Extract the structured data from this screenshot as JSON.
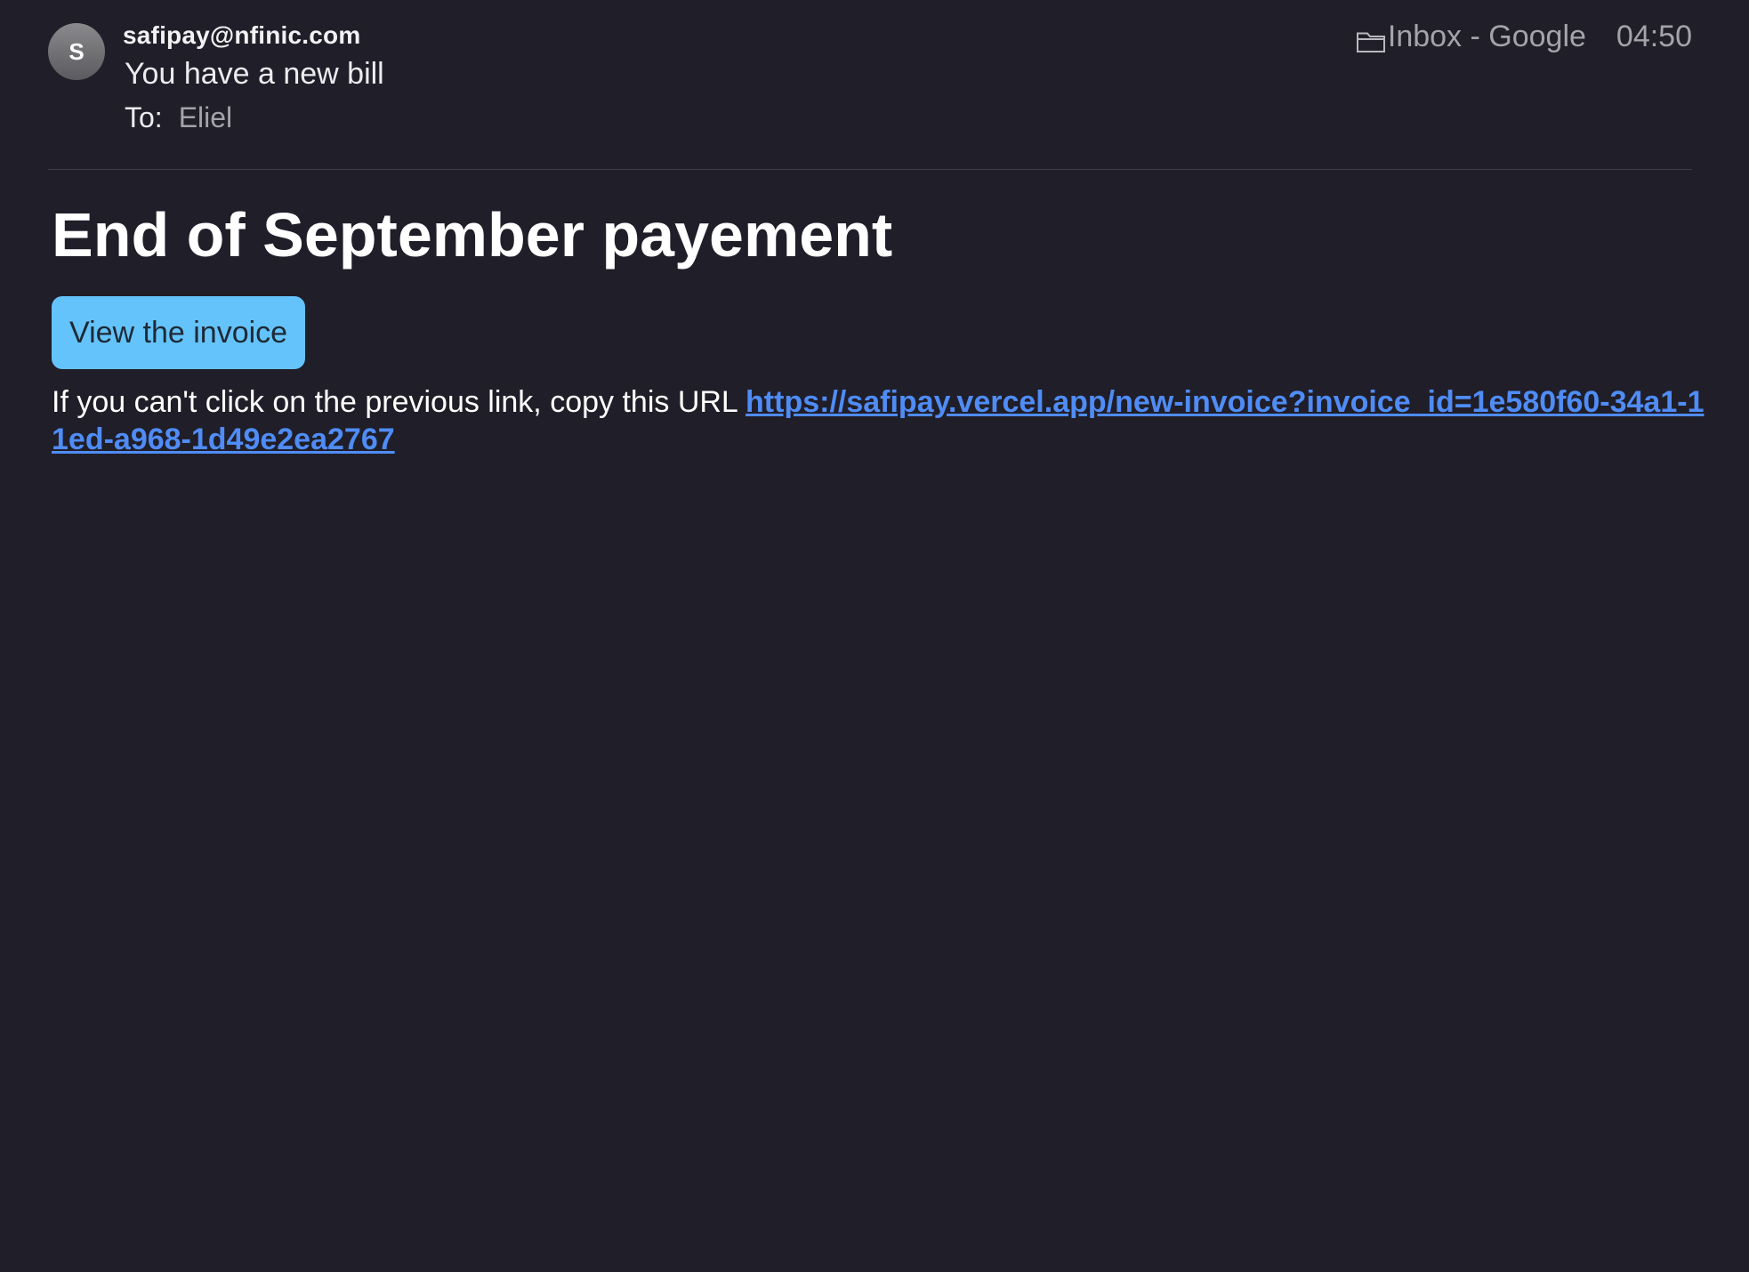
{
  "header": {
    "avatar_initial": "S",
    "sender": "safipay@nfinic.com",
    "subject": "You have a new bill",
    "to_label": "To:",
    "to_value": "Eliel",
    "folder": "Inbox - Google",
    "time": "04:50",
    "folder_icon": "folder-icon"
  },
  "body": {
    "title": "End of September payement",
    "button_label": "View the invoice",
    "fallback_text": "If you can't click on the previous link, copy this URL ",
    "fallback_url": "https://safipay.vercel.app/new-invoice?invoice_id=1e580f60-34a1-11ed-a968-1d49e2ea2767"
  },
  "colors": {
    "background": "#201e28",
    "button": "#65c3fb",
    "link": "#4f8cf6",
    "muted_text": "#a4a3aa"
  }
}
